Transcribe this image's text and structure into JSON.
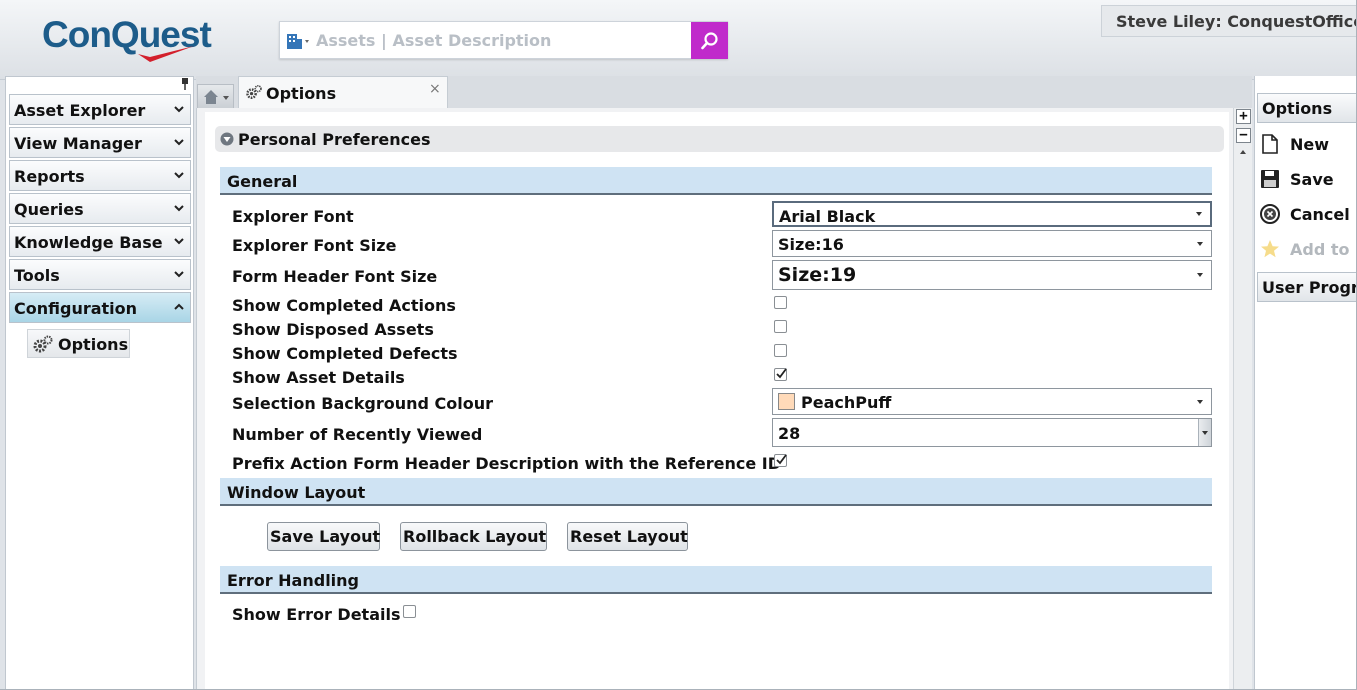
{
  "brand": {
    "logo_text": "ConQuest"
  },
  "search": {
    "placeholder": "Assets | Asset Description",
    "button_color": "#c02acb"
  },
  "user": {
    "display": "Steve Liley: ConquestOffice"
  },
  "left_nav": {
    "items": [
      {
        "label": "Asset Explorer",
        "state": "collapsed"
      },
      {
        "label": "View Manager",
        "state": "collapsed"
      },
      {
        "label": "Reports",
        "state": "collapsed"
      },
      {
        "label": "Queries",
        "state": "collapsed"
      },
      {
        "label": "Knowledge Base",
        "state": "collapsed"
      },
      {
        "label": "Tools",
        "state": "collapsed"
      },
      {
        "label": "Configuration",
        "state": "expanded"
      }
    ],
    "sub_items": [
      {
        "label": "Options",
        "icon": "gears-icon"
      }
    ]
  },
  "tabs": [
    {
      "label": "",
      "icon": "home-icon"
    },
    {
      "label": "Options",
      "icon": "gears-icon",
      "close": "×"
    }
  ],
  "panel": {
    "title": "Personal Preferences"
  },
  "sections": {
    "general": "General",
    "window_layout": "Window Layout",
    "error_handling": "Error Handling"
  },
  "general": {
    "explorer_font": {
      "label": "Explorer Font",
      "value": "Arial Black"
    },
    "explorer_font_size": {
      "label": "Explorer Font Size",
      "value": "Size:16"
    },
    "form_header_font_size": {
      "label": "Form Header Font Size",
      "value": "Size:19"
    },
    "show_completed_actions": {
      "label": "Show Completed Actions",
      "checked": false
    },
    "show_disposed_assets": {
      "label": "Show Disposed Assets",
      "checked": false
    },
    "show_completed_defects": {
      "label": "Show Completed Defects",
      "checked": false
    },
    "show_asset_details": {
      "label": "Show Asset Details",
      "checked": true
    },
    "selection_background_colour": {
      "label": "Selection Background Colour",
      "value": "PeachPuff",
      "swatch": "#ffdab9"
    },
    "recently_viewed": {
      "label": "Number of Recently Viewed",
      "value": "28"
    },
    "prefix_action": {
      "label": "Prefix Action Form Header Description with the Reference ID",
      "checked": true
    }
  },
  "window_layout": {
    "buttons": [
      "Save Layout",
      "Rollback Layout",
      "Reset Layout"
    ]
  },
  "error_handling": {
    "show_error_details": {
      "label": "Show Error Details",
      "checked": false
    }
  },
  "scrollbar": {
    "plus": "+",
    "minus": "−"
  },
  "right_panel": {
    "header": "Options",
    "actions": [
      {
        "label": "New",
        "icon": "new-document-icon",
        "enabled": true
      },
      {
        "label": "Save",
        "icon": "floppy-disk-icon",
        "enabled": true
      },
      {
        "label": "Cancel",
        "icon": "cancel-circle-icon",
        "enabled": true
      },
      {
        "label": "Add to Favourites",
        "icon": "star-icon",
        "enabled": false
      }
    ],
    "footer_header": "User Programs"
  }
}
